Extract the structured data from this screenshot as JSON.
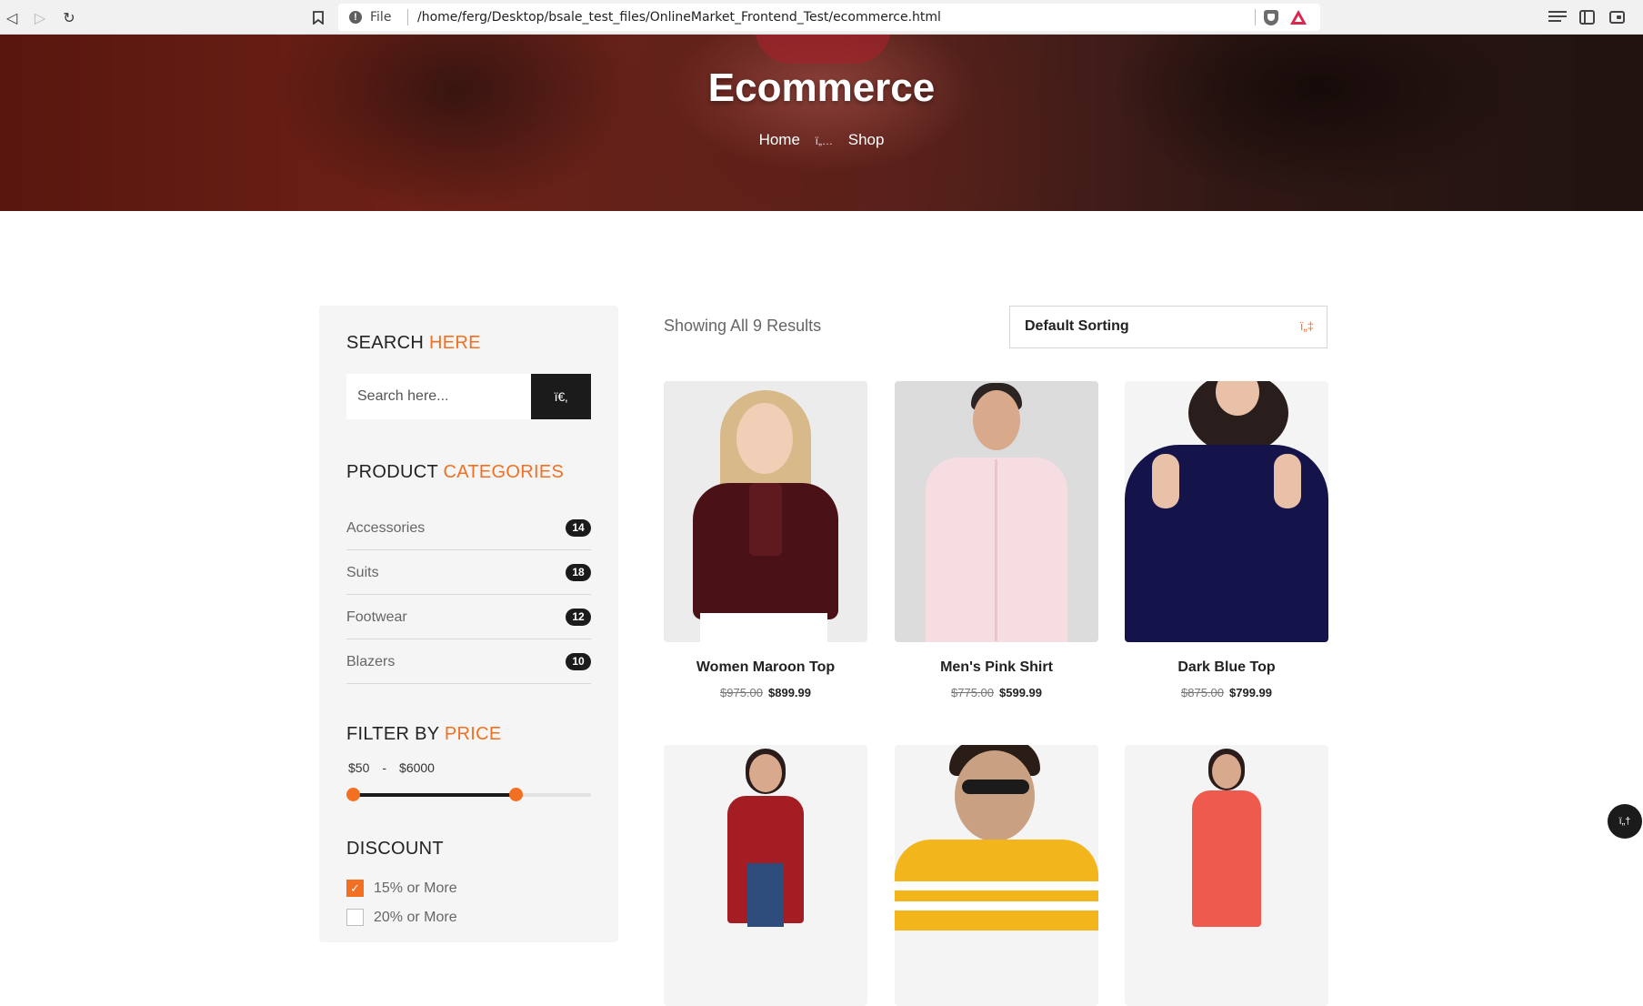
{
  "browser": {
    "file_label": "File",
    "url": "/home/ferg/Desktop/bsale_test_files/OnlineMarket_Frontend_Test/ecommerce.html"
  },
  "hero": {
    "title": "Ecommerce",
    "breadcrumb_home": "Home",
    "breadcrumb_sep": "ï„…",
    "breadcrumb_current": "Shop"
  },
  "sidebar": {
    "search_title_a": "SEARCH ",
    "search_title_b": "HERE",
    "search_placeholder": "Search here...",
    "search_button_glyph": "ï€‚",
    "categories_title_a": "PRODUCT ",
    "categories_title_b": "CATEGORIES",
    "categories": [
      {
        "label": "Accessories",
        "count": "14"
      },
      {
        "label": "Suits",
        "count": "18"
      },
      {
        "label": "Footwear",
        "count": "12"
      },
      {
        "label": "Blazers",
        "count": "10"
      }
    ],
    "price_title_a": "FILTER BY ",
    "price_title_b": "PRICE",
    "price_min": "$50",
    "price_dash": "-",
    "price_max": "$6000",
    "discount_title": "DISCOUNT",
    "discounts": [
      {
        "label": "15% or More",
        "checked": true
      },
      {
        "label": "20% or More",
        "checked": false
      }
    ]
  },
  "toolbar": {
    "results_text": "Showing All 9 Results",
    "sort_label": "Default Sorting",
    "sort_glyph": "ï„‡"
  },
  "products": [
    {
      "name": "Women Maroon Top",
      "old_price": "$975.00",
      "price": "$899.99"
    },
    {
      "name": "Men's Pink Shirt",
      "old_price": "$775.00",
      "price": "$599.99"
    },
    {
      "name": "Dark Blue Top",
      "old_price": "$875.00",
      "price": "$799.99"
    },
    {
      "name": "",
      "old_price": "",
      "price": ""
    },
    {
      "name": "",
      "old_price": "",
      "price": ""
    },
    {
      "name": "",
      "old_price": "",
      "price": ""
    }
  ],
  "scroll_top_glyph": "ï„†",
  "colors": {
    "accent": "#f36f21",
    "dark": "#1b1b1b"
  }
}
